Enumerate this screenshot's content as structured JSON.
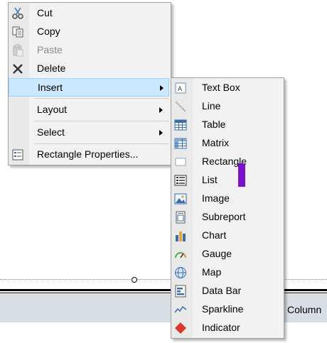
{
  "background": {
    "column_text": "Column"
  },
  "context_menu": {
    "items": [
      {
        "label": "Cut",
        "icon": "scissors-icon",
        "enabled": true
      },
      {
        "label": "Copy",
        "icon": "copy-icon",
        "enabled": true
      },
      {
        "label": "Paste",
        "icon": "paste-icon",
        "enabled": false
      },
      {
        "label": "Delete",
        "icon": "delete-icon",
        "enabled": true
      },
      {
        "label": "Insert",
        "has_submenu": true,
        "highlighted": true
      },
      {
        "label": "Layout",
        "has_submenu": true
      },
      {
        "label": "Select",
        "has_submenu": true
      },
      {
        "label": "Rectangle Properties...",
        "icon": "properties-icon"
      }
    ]
  },
  "insert_submenu": {
    "items": [
      {
        "label": "Text Box",
        "icon": "textbox-icon"
      },
      {
        "label": "Line",
        "icon": "line-icon"
      },
      {
        "label": "Table",
        "icon": "table-icon"
      },
      {
        "label": "Matrix",
        "icon": "matrix-icon"
      },
      {
        "label": "Rectangle",
        "icon": "rectangle-icon"
      },
      {
        "label": "List",
        "icon": "list-icon"
      },
      {
        "label": "Image",
        "icon": "image-icon"
      },
      {
        "label": "Subreport",
        "icon": "subreport-icon"
      },
      {
        "label": "Chart",
        "icon": "chart-icon"
      },
      {
        "label": "Gauge",
        "icon": "gauge-icon"
      },
      {
        "label": "Map",
        "icon": "map-icon"
      },
      {
        "label": "Data Bar",
        "icon": "databar-icon"
      },
      {
        "label": "Sparkline",
        "icon": "sparkline-icon"
      },
      {
        "label": "Indicator",
        "icon": "indicator-icon"
      }
    ]
  },
  "colors": {
    "menu_bg": "#f2f2f2",
    "highlight_bg": "#cce8ff",
    "highlight_border": "#99d1ff",
    "disabled_text": "#8c8c8c",
    "cursor_mark": "#7a12c9"
  }
}
